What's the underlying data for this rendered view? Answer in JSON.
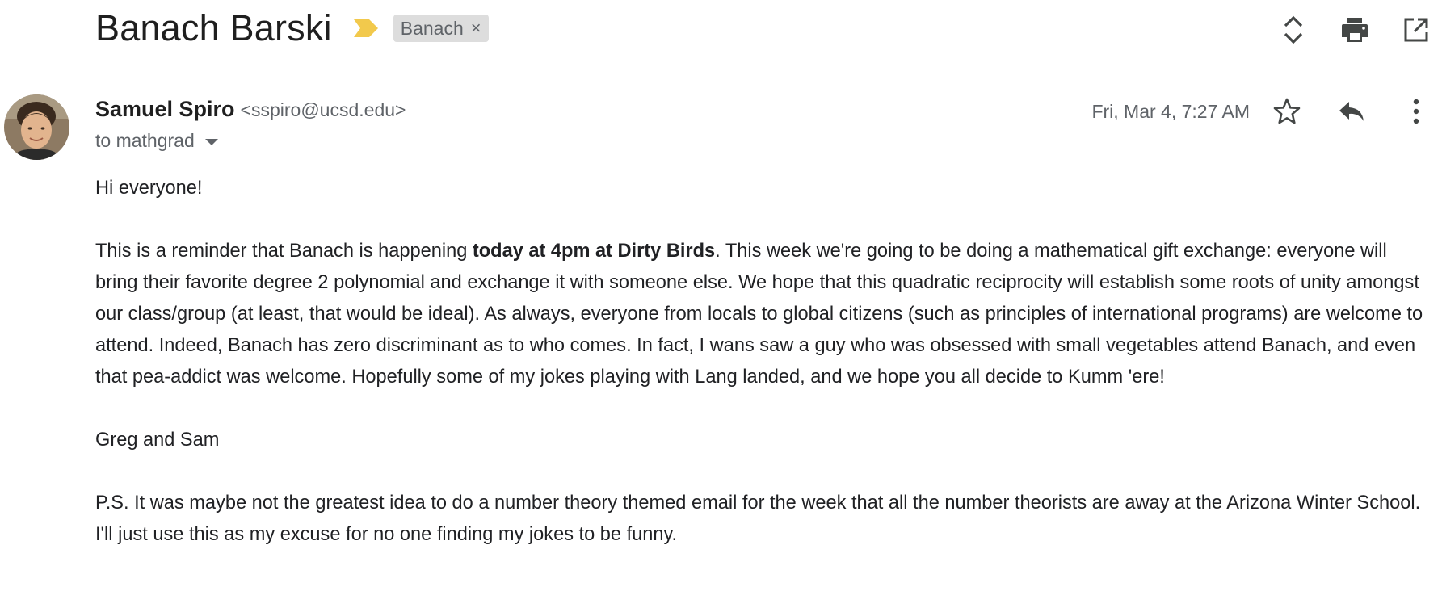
{
  "thread": {
    "subject": "Banach Barski",
    "label": "Banach",
    "label_remove_glyph": "×",
    "actions": [
      {
        "name": "expand-collapse-icon"
      },
      {
        "name": "print-icon"
      },
      {
        "name": "open-in-new-window-icon"
      }
    ]
  },
  "message": {
    "sender_name": "Samuel Spiro",
    "sender_email": "<sspiro@ucsd.edu>",
    "recipient": "to mathgrad",
    "date": "Fri, Mar 4, 7:27 AM",
    "actions": [
      {
        "name": "star-icon"
      },
      {
        "name": "reply-icon"
      },
      {
        "name": "more-options-icon"
      }
    ]
  },
  "body": {
    "greeting": "Hi everyone!",
    "para1_before": "This is a reminder that Banach is happening ",
    "para1_bold": "today at 4pm at Dirty Birds",
    "para1_after": ".  This week we're going to be doing a mathematical gift exchange: everyone will bring their favorite degree 2 polynomial and exchange it with someone else.  We hope that this quadratic reciprocity will establish some roots of unity amongst our class/group (at least, that would be ideal).  As always, everyone from locals to global citizens (such as principles of international programs) are welcome to attend.  Indeed, Banach has zero discriminant as to who comes.  In fact, I wans saw a guy who was obsessed with small vegetables attend Banach, and even that pea-addict was welcome.  Hopefully some of my jokes playing with Lang landed, and we hope you all decide to Kumm 'ere!",
    "signature": "Greg and Sam",
    "postscript": "P.S. It was maybe not the greatest idea to do a number theory themed email for the week that all the number theorists are away at the Arizona Winter School.  I'll just use this as my excuse for no one finding my jokes to be funny."
  },
  "colors": {
    "importance_marker": "#f2c94c",
    "label_chip_bg": "#dddddd",
    "icon": "#444746",
    "secondary_text": "#5f6368"
  }
}
